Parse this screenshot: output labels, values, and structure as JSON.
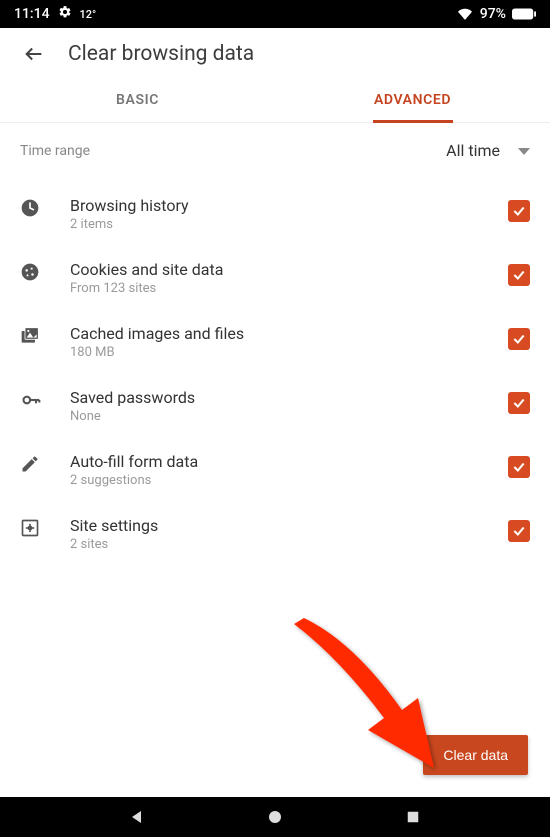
{
  "status": {
    "time": "11:14",
    "temp": "12°",
    "battery": "97%"
  },
  "header": {
    "title": "Clear browsing data"
  },
  "tabs": {
    "basic": "BASIC",
    "advanced": "ADVANCED"
  },
  "timeRange": {
    "label": "Time range",
    "value": "All time"
  },
  "items": [
    {
      "title": "Browsing history",
      "sub": "2 items"
    },
    {
      "title": "Cookies and site data",
      "sub": "From 123 sites"
    },
    {
      "title": "Cached images and files",
      "sub": "180 MB"
    },
    {
      "title": "Saved passwords",
      "sub": "None"
    },
    {
      "title": "Auto-fill form data",
      "sub": "2 suggestions"
    },
    {
      "title": "Site settings",
      "sub": "2 sites"
    }
  ],
  "action": {
    "clear": "Clear data"
  }
}
